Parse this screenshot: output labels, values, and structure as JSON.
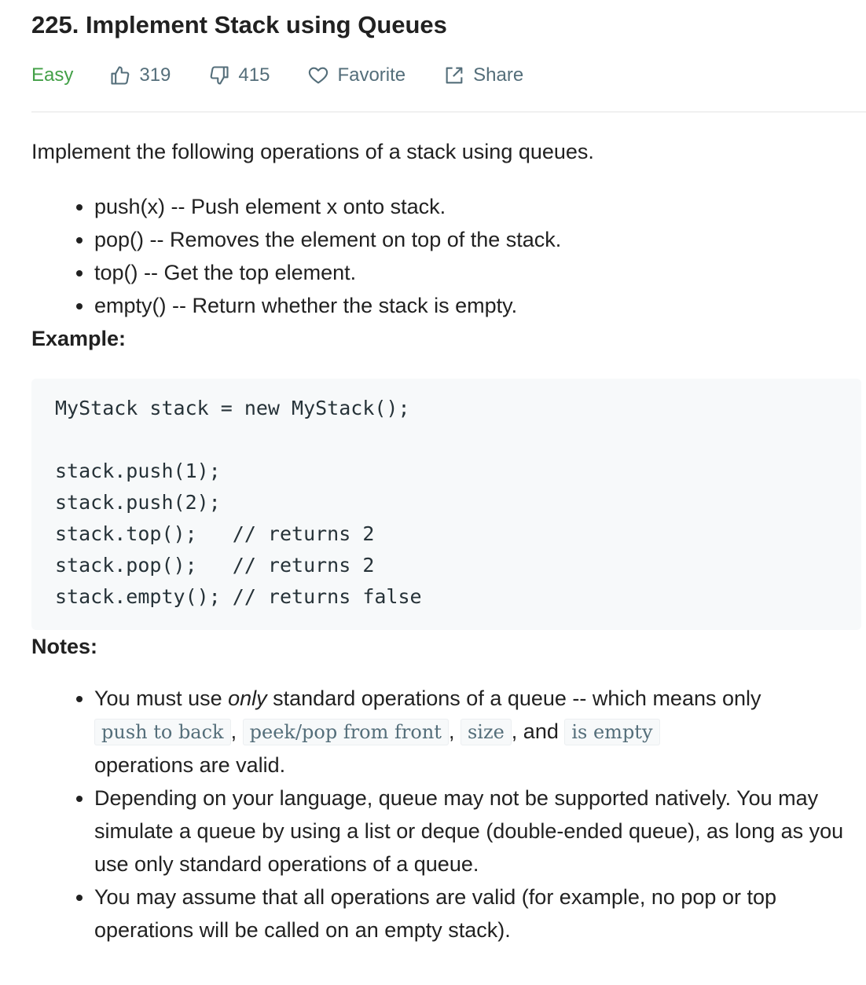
{
  "problem": {
    "title": "225. Implement Stack using Queues",
    "difficulty": "Easy",
    "likes": "319",
    "dislikes": "415",
    "favorite_label": "Favorite",
    "share_label": "Share"
  },
  "colors": {
    "difficulty_easy": "#43a047",
    "meta_text": "#546e7a",
    "code_bg": "#f7f9fa"
  },
  "description": {
    "intro": "Implement the following operations of a stack using queues.",
    "operations": [
      "push(x) -- Push element x onto stack.",
      "pop() -- Removes the element on top of the stack.",
      "top() -- Get the top element.",
      "empty() -- Return whether the stack is empty."
    ]
  },
  "example": {
    "heading": "Example:",
    "code_lines": [
      "MyStack stack = new MyStack();",
      "",
      "stack.push(1);",
      "stack.push(2);",
      "stack.top();   // returns 2",
      "stack.pop();   // returns 2",
      "stack.empty(); // returns false"
    ]
  },
  "notes": {
    "heading": "Notes:",
    "note1": {
      "t1": "You must use ",
      "em": "only",
      "t2": " standard operations of a queue -- which means only",
      "c1": "push to back",
      "s1": ", ",
      "c2": "peek/pop from front",
      "s2": ", ",
      "c3": "size",
      "s3": ", and ",
      "c4": "is empty",
      "t3": "operations are valid."
    },
    "note2": "Depending on your language, queue may not be supported natively. You may simulate a queue by using a list or deque (double-ended queue), as long as you use only standard operations of a queue.",
    "note3": "You may assume that all operations are valid (for example, no pop or top operations will be called on an empty stack)."
  }
}
